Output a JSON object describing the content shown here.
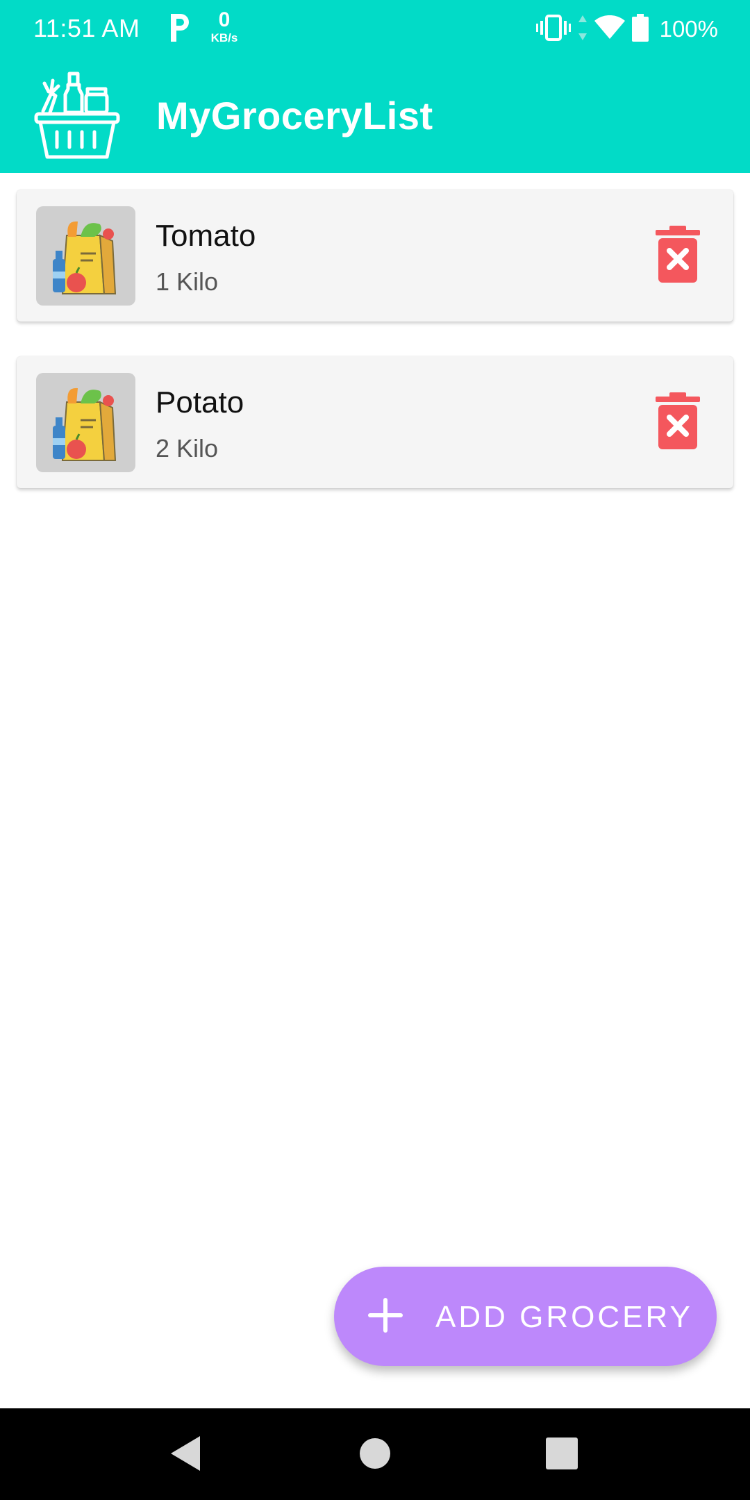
{
  "status_bar": {
    "time": "11:51 AM",
    "net_speed_value": "0",
    "net_speed_unit": "KB/s",
    "battery": "100%"
  },
  "toolbar": {
    "title": "MyGroceryList",
    "color": "#02dbc7"
  },
  "groceries": [
    {
      "name": "Tomato",
      "quantity": "1 Kilo",
      "icon": "grocery-bag-icon"
    },
    {
      "name": "Potato",
      "quantity": "2 Kilo",
      "icon": "grocery-bag-icon"
    }
  ],
  "fab": {
    "label": "ADD GROCERY",
    "icon": "plus-icon",
    "color": "#bd88fb"
  },
  "accents": {
    "delete": "#f4575d"
  },
  "nav_bar": {
    "buttons": [
      "back-icon",
      "home-icon",
      "recents-icon"
    ]
  }
}
